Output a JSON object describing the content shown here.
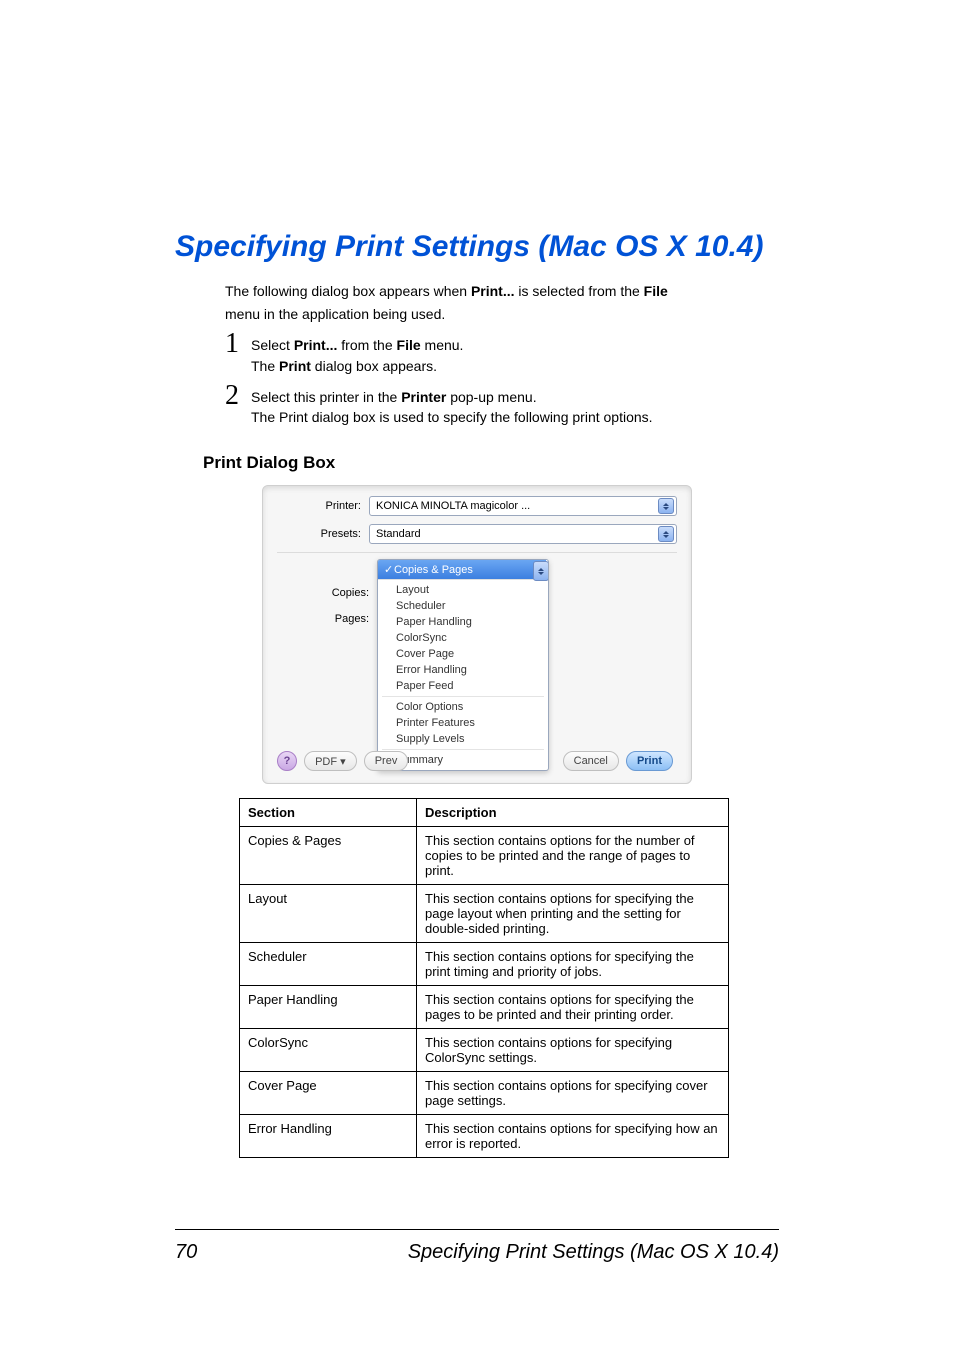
{
  "heading": "Specifying Print Settings (Mac OS X 10.4)",
  "intro": {
    "l1_a": "The following dialog box appears when ",
    "l1_b": "Print...",
    "l1_c": " is selected from the ",
    "l1_d": "File",
    "l2": "menu in the application being used."
  },
  "steps": {
    "s1": {
      "n": "1",
      "a": "Select ",
      "b": "Print...",
      "c": " from the ",
      "d": "File",
      "e": " menu.",
      "sub_a": "The ",
      "sub_b": "Print",
      "sub_c": " dialog box appears."
    },
    "s2": {
      "n": "2",
      "a": "Select this printer in the ",
      "b": "Printer",
      "c": " pop-up menu.",
      "sub": "The Print dialog box is used to specify the following print options."
    }
  },
  "subheading": "Print Dialog Box",
  "dialog": {
    "printer_label": "Printer:",
    "printer_value": "KONICA MINOLTA magicolor ...",
    "presets_label": "Presets:",
    "presets_value": "Standard",
    "copies_label": "Copies:",
    "pages_label": "Pages:",
    "selected": "Copies & Pages",
    "items": [
      "Layout",
      "Scheduler",
      "Paper Handling",
      "ColorSync",
      "Cover Page",
      "Error Handling",
      "Paper Feed",
      "Color Options",
      "Printer Features",
      "Supply Levels",
      "Summary"
    ],
    "help": "?",
    "pdf": "PDF ▾",
    "preview": "Prev",
    "cancel": "Cancel",
    "print": "Print"
  },
  "table": {
    "h1": "Section",
    "h2": "Description",
    "rows": [
      {
        "s": "Copies & Pages",
        "d": "This section contains options for the number of copies to be printed and the range of pages to print."
      },
      {
        "s": "Layout",
        "d": "This section contains options for specifying the page layout when printing and the setting for double-sided printing."
      },
      {
        "s": "Scheduler",
        "d": "This section contains options for specifying the print timing and priority of jobs."
      },
      {
        "s": "Paper Handling",
        "d": "This section contains options for specifying the pages to be printed and their printing order."
      },
      {
        "s": "ColorSync",
        "d": "This section contains options for specifying ColorSync settings."
      },
      {
        "s": "Cover Page",
        "d": "This section contains options for specifying cover page settings."
      },
      {
        "s": "Error Handling",
        "d": "This section contains options for specifying how an error is reported."
      }
    ]
  },
  "footer": {
    "page": "70",
    "title": "Specifying Print Settings (Mac OS X 10.4)"
  }
}
